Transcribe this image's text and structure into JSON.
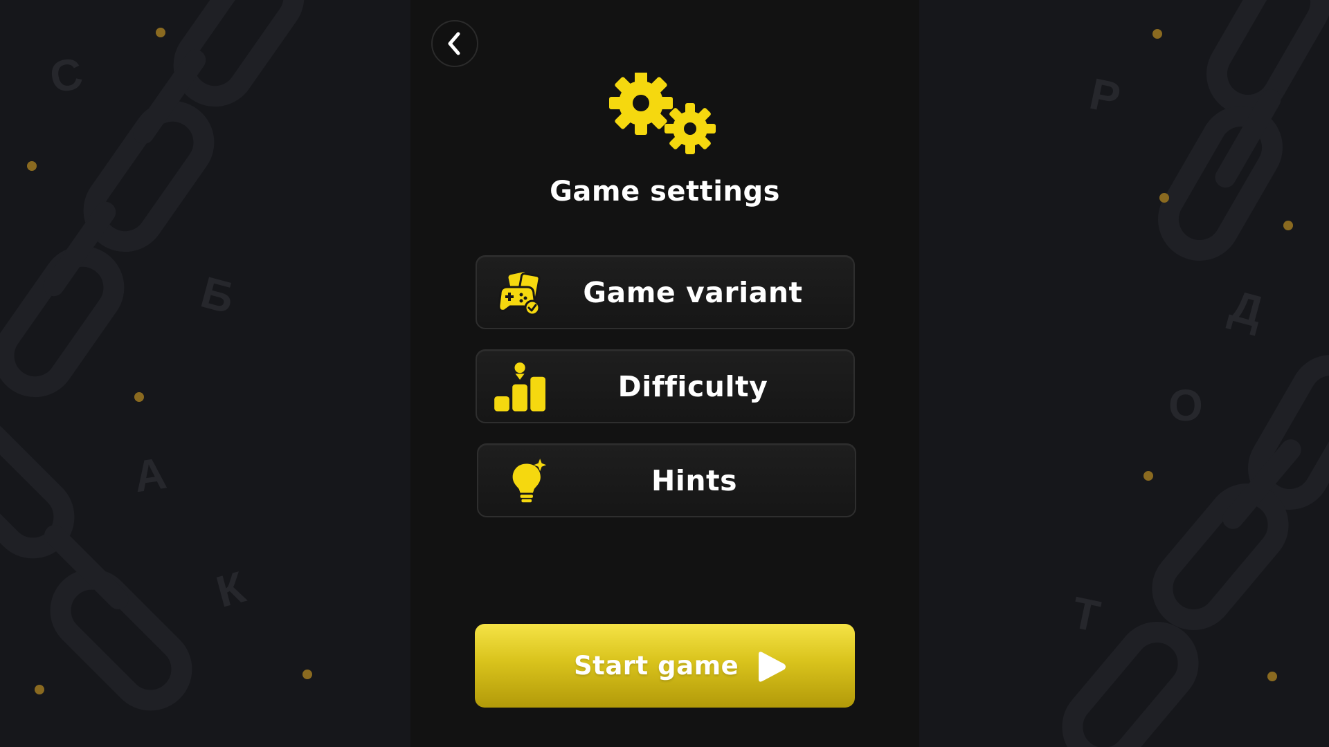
{
  "title": "Game settings",
  "menu": [
    {
      "label": "Game variant",
      "icon": "gamepad-cards-icon"
    },
    {
      "label": "Difficulty",
      "icon": "difficulty-bars-icon"
    },
    {
      "label": "Hints",
      "icon": "lightbulb-icon"
    }
  ],
  "start_button": {
    "label": "Start game",
    "icon": "play-icon"
  },
  "back_button": {
    "icon": "chevron-left-icon"
  },
  "header_icon": "gears-icon",
  "background_letters": {
    "left": [
      "С",
      "Б",
      "А",
      "К"
    ],
    "right": [
      "Р",
      "Д",
      "О",
      "Т"
    ]
  },
  "colors": {
    "accent": "#f5d80f",
    "panel": "#121212",
    "background": "#16171b",
    "button_border": "#2e2e2e",
    "text": "#ffffff"
  }
}
